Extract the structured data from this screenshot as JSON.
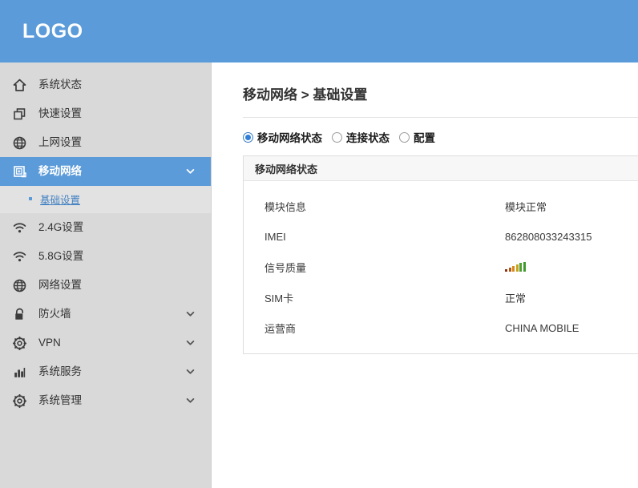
{
  "header": {
    "logo": "LOGO",
    "bg_color": "#5b9bd9"
  },
  "sidebar": {
    "bg_color": "#d9d9d9",
    "active_color": "#5b9bd9",
    "items": [
      {
        "label": "系统状态",
        "icon": "home-icon",
        "has_chevron": false,
        "active": false
      },
      {
        "label": "快速设置",
        "icon": "copy-icon",
        "has_chevron": false,
        "active": false
      },
      {
        "label": "上网设置",
        "icon": "globe-icon",
        "has_chevron": false,
        "active": false
      },
      {
        "label": "移动网络",
        "icon": "mobile-network-icon",
        "has_chevron": true,
        "active": true
      },
      {
        "label": "2.4G设置",
        "icon": "wifi-icon",
        "has_chevron": false,
        "active": false
      },
      {
        "label": "5.8G设置",
        "icon": "wifi-icon",
        "has_chevron": false,
        "active": false
      },
      {
        "label": "网络设置",
        "icon": "globe-icon",
        "has_chevron": false,
        "active": false
      },
      {
        "label": "防火墙",
        "icon": "lock-icon",
        "has_chevron": true,
        "active": false
      },
      {
        "label": "VPN",
        "icon": "gear-icon",
        "has_chevron": true,
        "active": false
      },
      {
        "label": "系统服务",
        "icon": "bar-chart-icon",
        "has_chevron": true,
        "active": false
      },
      {
        "label": "系统管理",
        "icon": "gear-icon",
        "has_chevron": true,
        "active": false
      }
    ],
    "submenu": {
      "parent_index": 3,
      "items": [
        {
          "label": "基础设置",
          "selected": true
        }
      ]
    }
  },
  "main": {
    "breadcrumb": "移动网络 > 基础设置",
    "radio_options": [
      {
        "label": "移动网络状态",
        "selected": true
      },
      {
        "label": "连接状态",
        "selected": false
      },
      {
        "label": "配置",
        "selected": false
      }
    ],
    "panel": {
      "title": "移动网络状态",
      "rows": [
        {
          "label": "模块信息",
          "value": "模块正常",
          "type": "text"
        },
        {
          "label": "IMEI",
          "value": "862808033243315",
          "type": "text"
        },
        {
          "label": "信号质量",
          "value": "",
          "type": "signal"
        },
        {
          "label": "SIM卡",
          "value": "正常",
          "type": "text"
        },
        {
          "label": "运营商",
          "value": "CHINA MOBILE",
          "type": "text"
        }
      ],
      "signal": {
        "bars": [
          {
            "height": 3,
            "color": "#8c2f0a"
          },
          {
            "height": 5,
            "color": "#b5560f"
          },
          {
            "height": 7,
            "color": "#d9881b"
          },
          {
            "height": 9,
            "color": "#c8a31e"
          },
          {
            "height": 11,
            "color": "#4f9f35"
          },
          {
            "height": 12,
            "color": "#3f9a2e"
          }
        ]
      }
    }
  }
}
